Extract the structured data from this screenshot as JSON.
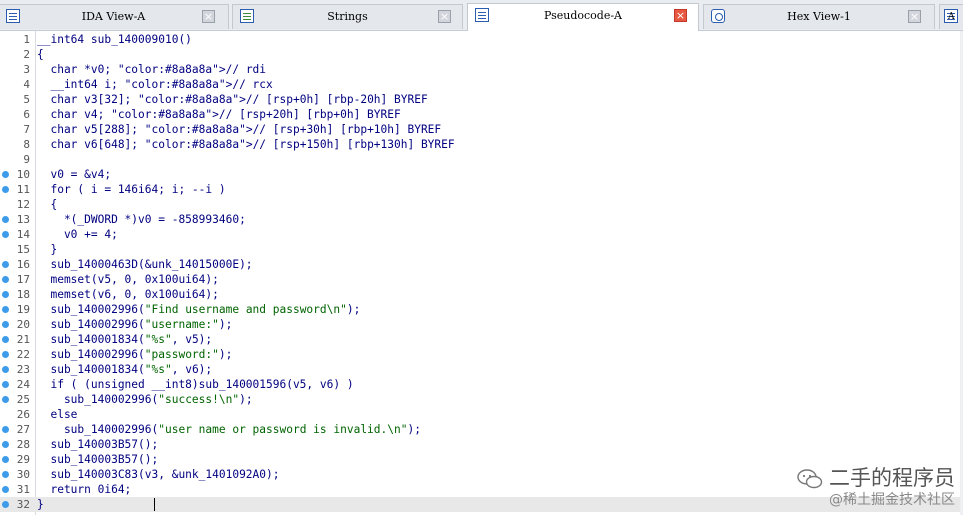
{
  "tabs": [
    {
      "label": "IDA View-A",
      "icon": "listing-icon",
      "active": false
    },
    {
      "label": "Strings",
      "icon": "strings-icon",
      "active": false
    },
    {
      "label": "Pseudocode-A",
      "icon": "pseudocode-icon",
      "active": true
    },
    {
      "label": "Hex View-1",
      "icon": "hex-icon",
      "active": false
    },
    {
      "label": "A",
      "icon": "structures-icon",
      "active": false
    }
  ],
  "close_glyph": "×",
  "colors": {
    "code_text": "#000080",
    "comment_gray": "#8a8a8a",
    "string_green": "#006400",
    "breakpoint_blue": "#3d9be9",
    "active_close_red": "#e8573f"
  },
  "code_lines": [
    {
      "num": "1",
      "bp": false,
      "text": "__int64 sub_140009010()"
    },
    {
      "num": "2",
      "bp": false,
      "text": "{"
    },
    {
      "num": "3",
      "bp": false,
      "text": "  char *v0; // rdi"
    },
    {
      "num": "4",
      "bp": false,
      "text": "  __int64 i; // rcx"
    },
    {
      "num": "5",
      "bp": false,
      "text": "  char v3[32]; // [rsp+0h] [rbp-20h] BYREF"
    },
    {
      "num": "6",
      "bp": false,
      "text": "  char v4; // [rsp+20h] [rbp+0h] BYREF"
    },
    {
      "num": "7",
      "bp": false,
      "text": "  char v5[288]; // [rsp+30h] [rbp+10h] BYREF"
    },
    {
      "num": "8",
      "bp": false,
      "text": "  char v6[648]; // [rsp+150h] [rbp+130h] BYREF"
    },
    {
      "num": "9",
      "bp": false,
      "text": ""
    },
    {
      "num": "10",
      "bp": true,
      "text": "  v0 = &v4;"
    },
    {
      "num": "11",
      "bp": true,
      "text": "  for ( i = 146i64; i; --i )"
    },
    {
      "num": "12",
      "bp": false,
      "text": "  {"
    },
    {
      "num": "13",
      "bp": true,
      "text": "    *(_DWORD *)v0 = -858993460;"
    },
    {
      "num": "14",
      "bp": true,
      "text": "    v0 += 4;"
    },
    {
      "num": "15",
      "bp": false,
      "text": "  }"
    },
    {
      "num": "16",
      "bp": true,
      "text": "  sub_14000463D(&unk_14015000E);"
    },
    {
      "num": "17",
      "bp": true,
      "text": "  memset(v5, 0, 0x100ui64);"
    },
    {
      "num": "18",
      "bp": true,
      "text": "  memset(v6, 0, 0x100ui64);"
    },
    {
      "num": "19",
      "bp": true,
      "text": "  sub_140002996(\"Find username and password\\n\");"
    },
    {
      "num": "20",
      "bp": true,
      "text": "  sub_140002996(\"username:\");"
    },
    {
      "num": "21",
      "bp": true,
      "text": "  sub_140001834(\"%s\", v5);"
    },
    {
      "num": "22",
      "bp": true,
      "text": "  sub_140002996(\"password:\");"
    },
    {
      "num": "23",
      "bp": true,
      "text": "  sub_140001834(\"%s\", v6);"
    },
    {
      "num": "24",
      "bp": true,
      "text": "  if ( (unsigned __int8)sub_140001596(v5, v6) )"
    },
    {
      "num": "25",
      "bp": true,
      "text": "    sub_140002996(\"success!\\n\");"
    },
    {
      "num": "26",
      "bp": false,
      "text": "  else"
    },
    {
      "num": "27",
      "bp": true,
      "text": "    sub_140002996(\"user name or password is invalid.\\n\");"
    },
    {
      "num": "28",
      "bp": true,
      "text": "  sub_140003B57();"
    },
    {
      "num": "29",
      "bp": true,
      "text": "  sub_140003B57();"
    },
    {
      "num": "30",
      "bp": true,
      "text": "  sub_140003C83(v3, &unk_1401092A0);"
    },
    {
      "num": "31",
      "bp": true,
      "text": "  return 0i64;"
    },
    {
      "num": "32",
      "bp": true,
      "text": "}"
    }
  ],
  "current_line": "32",
  "watermark": {
    "title": "二手的程序员",
    "subtitle": "@稀土掘金技术社区"
  }
}
